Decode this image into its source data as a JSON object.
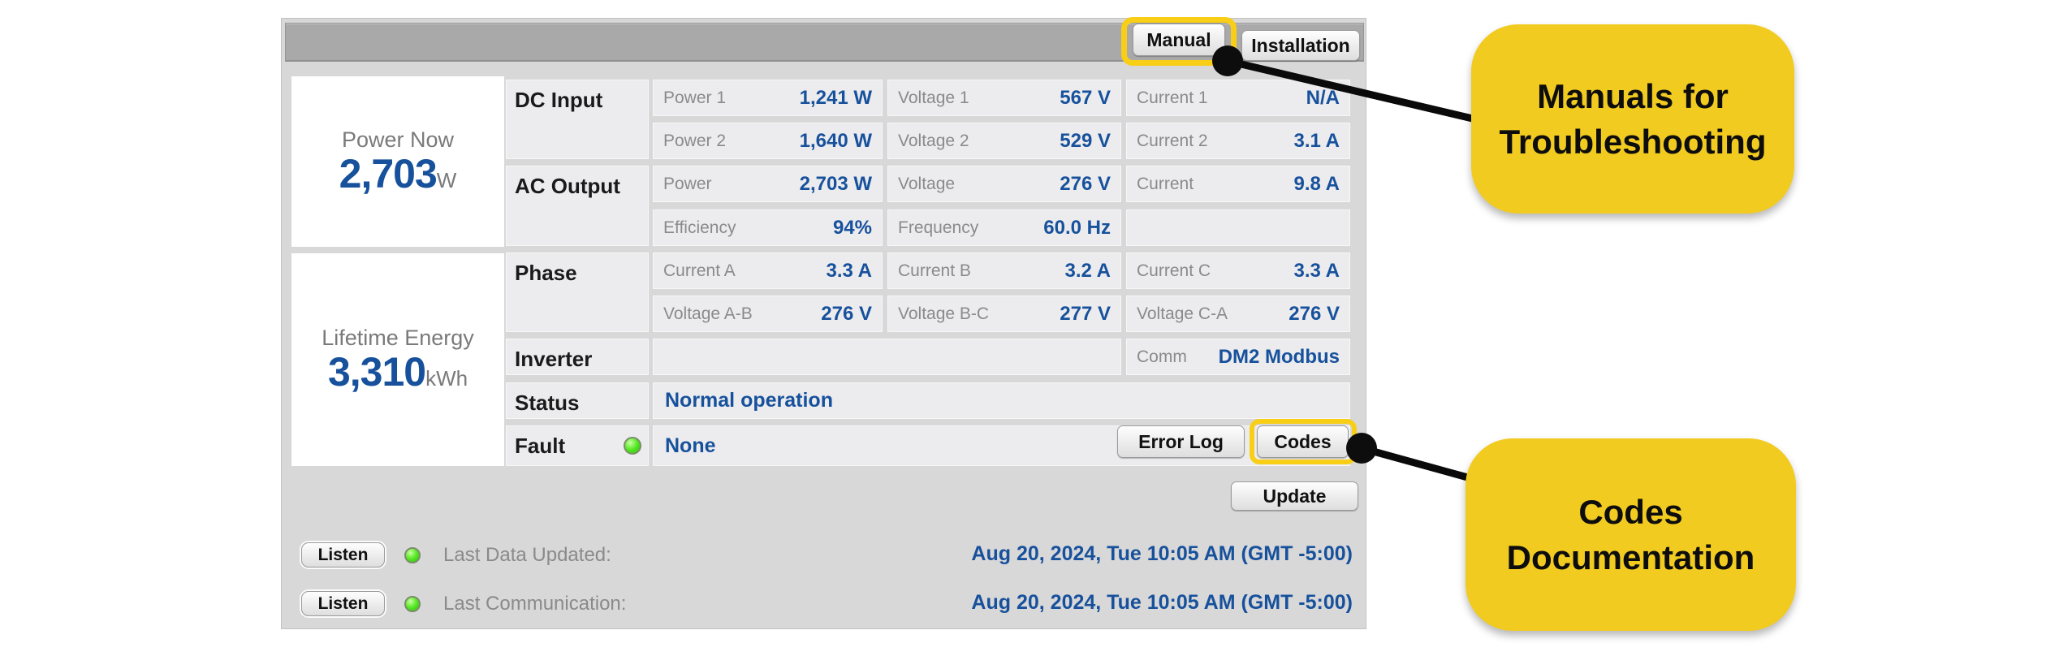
{
  "toolbar": {
    "manual": "Manual",
    "installation": "Installation"
  },
  "summary": {
    "power_now": {
      "label": "Power Now",
      "value": "2,703",
      "unit": "W"
    },
    "lifetime": {
      "label": "Lifetime Energy",
      "value": "3,310",
      "unit": "kWh"
    }
  },
  "grid": {
    "dc": {
      "title": "DC Input",
      "r1": [
        {
          "l": "Power 1",
          "v": "1,241 W"
        },
        {
          "l": "Voltage 1",
          "v": "567 V"
        },
        {
          "l": "Current 1",
          "v": "N/A"
        }
      ],
      "r2": [
        {
          "l": "Power 2",
          "v": "1,640 W"
        },
        {
          "l": "Voltage 2",
          "v": "529 V"
        },
        {
          "l": "Current 2",
          "v": "3.1 A"
        }
      ]
    },
    "ac": {
      "title": "AC Output",
      "r1": [
        {
          "l": "Power",
          "v": "2,703 W"
        },
        {
          "l": "Voltage",
          "v": "276 V"
        },
        {
          "l": "Current",
          "v": "9.8 A"
        }
      ],
      "r2": [
        {
          "l": "Efficiency",
          "v": "94%"
        },
        {
          "l": "Frequency",
          "v": "60.0 Hz"
        }
      ]
    },
    "phase": {
      "title": "Phase",
      "r1": [
        {
          "l": "Current A",
          "v": "3.3 A"
        },
        {
          "l": "Current B",
          "v": "3.2 A"
        },
        {
          "l": "Current C",
          "v": "3.3 A"
        }
      ],
      "r2": [
        {
          "l": "Voltage A-B",
          "v": "276 V"
        },
        {
          "l": "Voltage B-C",
          "v": "277 V"
        },
        {
          "l": "Voltage C-A",
          "v": "276 V"
        }
      ]
    },
    "inverter": {
      "title": "Inverter",
      "comm_l": "Comm",
      "comm_v": "DM2 Modbus"
    },
    "status": {
      "title": "Status",
      "value": "Normal operation"
    },
    "fault": {
      "title": "Fault",
      "value": "None",
      "error_log": "Error Log",
      "codes": "Codes"
    }
  },
  "buttons": {
    "update": "Update"
  },
  "footer": {
    "listen": "Listen",
    "rows": [
      {
        "label": "Last Data Updated:",
        "value": "Aug 20, 2024, Tue 10:05 AM (GMT -5:00)"
      },
      {
        "label": "Last Communication:",
        "value": "Aug 20, 2024, Tue 10:05 AM (GMT -5:00)"
      }
    ]
  },
  "callouts": {
    "manual": {
      "line1": "Manuals for",
      "line2": "Troubleshooting"
    },
    "codes": {
      "line1": "Codes",
      "line2": "Documentation"
    }
  },
  "colors": {
    "value_blue": "#17519C",
    "callout_yellow": "#F2CB20",
    "highlight_yellow": "#F9CE17",
    "led_green": "#55E822"
  }
}
